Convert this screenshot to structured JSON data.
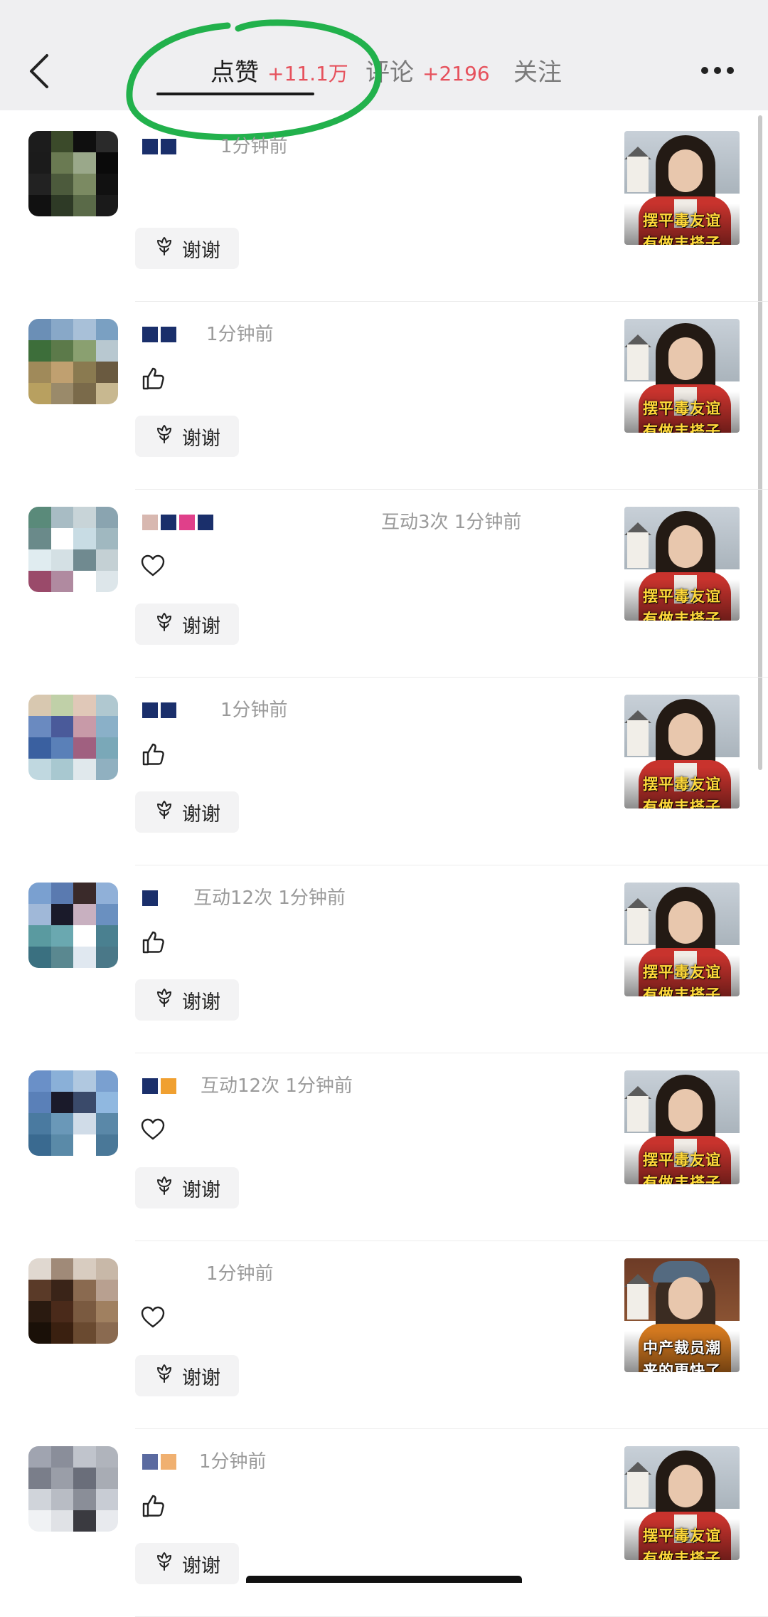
{
  "header": {
    "tabs": [
      {
        "label": "点赞",
        "count": "+11.1万",
        "active": true
      },
      {
        "label": "评论",
        "count": "+2196",
        "active": false
      },
      {
        "label": "关注",
        "count": "",
        "active": false
      }
    ]
  },
  "thanks_label": "谢谢",
  "items": [
    {
      "meta": "1分钟前",
      "reaction": "none",
      "thumb_caption": [
        "摆平毒友谊",
        "有做丰搭子"
      ],
      "thumb": "red"
    },
    {
      "meta": "1分钟前",
      "reaction": "thumb",
      "thumb_caption": [
        "摆平毒友谊",
        "有做丰搭子"
      ],
      "thumb": "red"
    },
    {
      "meta": "互动3次 1分钟前",
      "reaction": "heart",
      "thumb_caption": [
        "摆平毒友谊",
        "有做丰搭子"
      ],
      "thumb": "red"
    },
    {
      "meta": "1分钟前",
      "reaction": "thumb",
      "thumb_caption": [
        "摆平毒友谊",
        "有做丰搭子"
      ],
      "thumb": "red"
    },
    {
      "meta": "互动12次 1分钟前",
      "reaction": "thumb",
      "thumb_caption": [
        "摆平毒友谊",
        "有做丰搭子"
      ],
      "thumb": "red"
    },
    {
      "meta": "互动12次 1分钟前",
      "reaction": "heart",
      "thumb_caption": [
        "摆平毒友谊",
        "有做丰搭子"
      ],
      "thumb": "red"
    },
    {
      "meta": "1分钟前",
      "reaction": "heart",
      "thumb_caption": [
        "中产裁员潮",
        "来的更快了"
      ],
      "thumb": "orange"
    },
    {
      "meta": "1分钟前",
      "reaction": "thumb",
      "thumb_caption": [
        "摆平毒友谊",
        "有做丰搭子"
      ],
      "thumb": "red"
    }
  ],
  "colors": {
    "accent_count": "#e6515c",
    "annotation_circle": "#22b14c"
  }
}
